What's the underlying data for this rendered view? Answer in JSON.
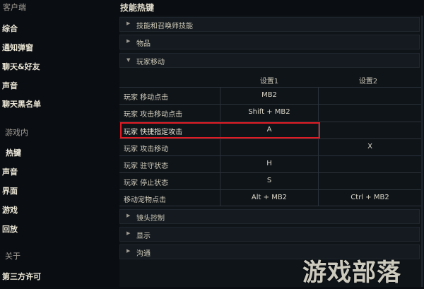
{
  "sidebar": {
    "client_head": "客户端",
    "client_items": [
      "综合",
      "通知弹窗",
      "聊天&好友",
      "声音",
      "聊天黑名单"
    ],
    "ingame_head": "游戏内",
    "ingame_items": [
      "热键",
      "声音",
      "界面",
      "游戏",
      "回放"
    ],
    "about_head": "关于",
    "about_items": [
      "第三方许可"
    ]
  },
  "main": {
    "title": "技能热键",
    "sections_top": [
      "技能和召唤师技能",
      "物品"
    ],
    "expanded_section": "玩家移动",
    "sections_bottom": [
      "镜头控制",
      "显示",
      "沟通"
    ]
  },
  "table": {
    "col1": "设置1",
    "col2": "设置2",
    "rows": [
      {
        "name": "玩家 移动点击",
        "k1": "MB2",
        "k2": ""
      },
      {
        "name": "玩家 攻击移动点击",
        "k1": "Shift + MB2",
        "k2": ""
      },
      {
        "name": "玩家 快捷指定攻击",
        "k1": "A",
        "k2": ""
      },
      {
        "name": "玩家 攻击移动",
        "k1": "",
        "k2": "X"
      },
      {
        "name": "玩家 驻守状态",
        "k1": "H",
        "k2": ""
      },
      {
        "name": "玩家 停止状态",
        "k1": "S",
        "k2": ""
      },
      {
        "name": "移动宠物点击",
        "k1": "Alt + MB2",
        "k2": "Ctrl + MB2"
      }
    ]
  },
  "watermark": "游戏部落",
  "colors": {
    "highlight": "#e01b24",
    "background": "#0a0d12"
  },
  "icons": {
    "collapsed": "triangle-right-icon",
    "expanded": "triangle-down-icon"
  }
}
